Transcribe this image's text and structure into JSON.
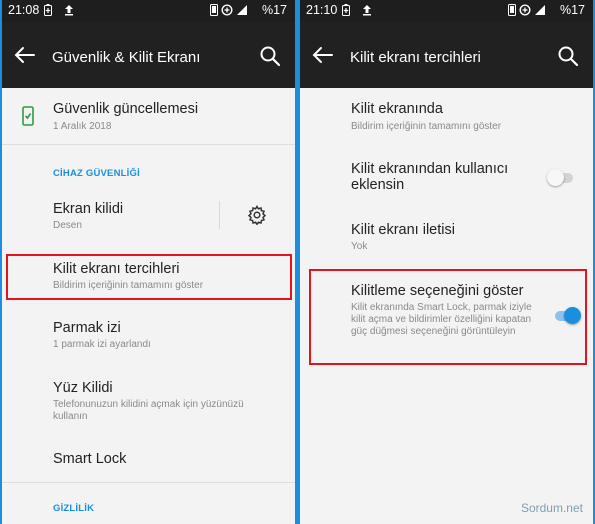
{
  "left": {
    "status": {
      "time": "21:08",
      "battery": "%17"
    },
    "title": "Güvenlik & Kilit Ekranı",
    "security_update": {
      "title": "Güvenlik güncellemesi",
      "subtitle": "1 Aralık 2018"
    },
    "section_device": "CİHAZ GÜVENLİĞİ",
    "screen_lock": {
      "title": "Ekran kilidi",
      "subtitle": "Desen"
    },
    "lock_prefs": {
      "title": "Kilit ekranı tercihleri",
      "subtitle": "Bildirim içeriğinin tamamını göster"
    },
    "fingerprint": {
      "title": "Parmak izi",
      "subtitle": "1 parmak izi ayarlandı"
    },
    "face_unlock": {
      "title": "Yüz Kilidi",
      "subtitle": "Telefonunuzun kilidini açmak için yüzünüzü kullanın"
    },
    "smart_lock": {
      "title": "Smart Lock"
    },
    "section_privacy": "GİZLİLİK"
  },
  "right": {
    "status": {
      "time": "21:10",
      "battery": "%17"
    },
    "title": "Kilit ekranı tercihleri",
    "on_lock_screen": {
      "title": "Kilit ekranında",
      "subtitle": "Bildirim içeriğinin tamamını göster"
    },
    "add_users": {
      "title": "Kilit ekranından kullanıcı eklensin",
      "enabled": false
    },
    "lock_message": {
      "title": "Kilit ekranı iletisi",
      "subtitle": "Yok"
    },
    "show_lockdown": {
      "title": "Kilitleme seçeneğini göster",
      "subtitle": "Kilit ekranında Smart Lock, parmak iziyle kilit açma ve bildirimler özelliğini kapatan güç düğmesi seçeneğini görüntüleyin",
      "enabled": true
    }
  },
  "watermark": "Sordum.net",
  "colors": {
    "accent": "#1a8fe0",
    "highlight": "#e0161e",
    "appbar": "#212121",
    "statusbar": "#1e1e1e"
  }
}
